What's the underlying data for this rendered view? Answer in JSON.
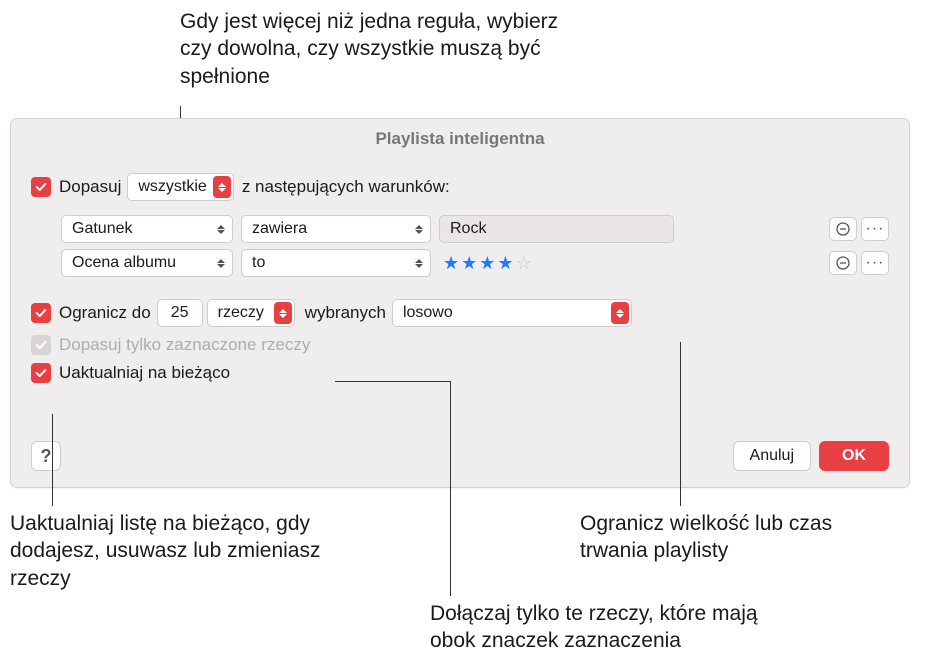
{
  "annotations": {
    "top": "Gdy jest więcej niż jedna reguła, wybierz czy dowolna, czy wszystkie muszą być spełnione",
    "bottom_left": "Uaktualniaj listę na bieżąco, gdy dodajesz, usuwasz lub zmieniasz rzeczy",
    "bottom_mid": "Dołączaj tylko te rzeczy, które mają obok znaczek zaznaczenia",
    "bottom_right": "Ogranicz wielkość lub czas trwania playlisty"
  },
  "dialog": {
    "title": "Playlista inteligentna",
    "match": {
      "label": "Dopasuj",
      "mode": "wszystkie",
      "suffix": "z następujących warunków:"
    },
    "rules": [
      {
        "field": "Gatunek",
        "operator": "zawiera",
        "value": "Rock",
        "value_type": "text"
      },
      {
        "field": "Ocena albumu",
        "operator": "to",
        "value_type": "stars",
        "stars_filled": 4,
        "stars_total": 5
      }
    ],
    "limit": {
      "label": "Ogranicz do",
      "count": "25",
      "unit": "rzeczy",
      "selected_label": "wybranych",
      "method": "losowo"
    },
    "match_checked": {
      "label": "Dopasuj tylko zaznaczone rzeczy"
    },
    "live_update": {
      "label": "Uaktualniaj na bieżąco"
    },
    "buttons": {
      "help": "?",
      "cancel": "Anuluj",
      "ok": "OK"
    }
  }
}
